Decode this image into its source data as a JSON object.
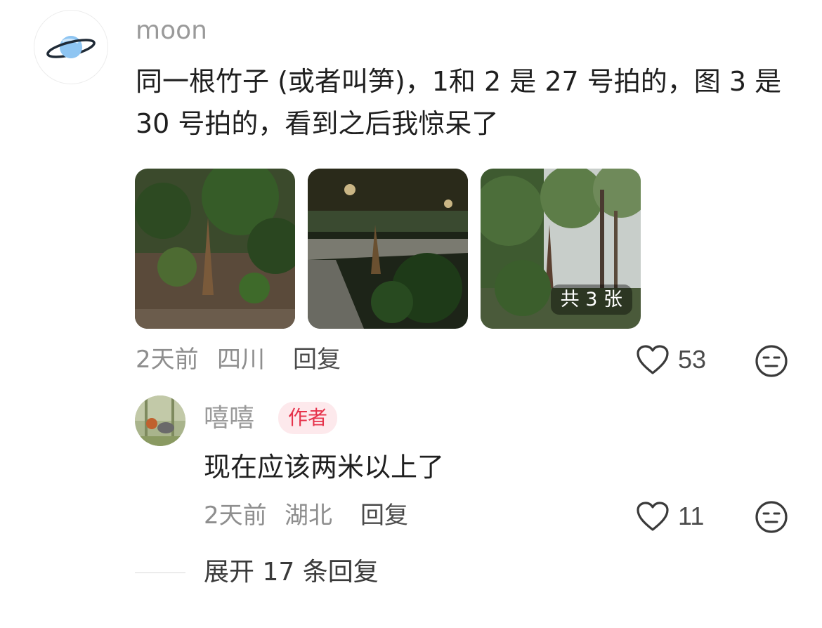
{
  "main_comment": {
    "username": "moon",
    "text": "同一根竹子 (或者叫笋)，1和 2 是 27 号拍的，图 3 是 30 号拍的，看到之后我惊呆了",
    "images": [
      {
        "alt": "bamboo-shoot-photo-1"
      },
      {
        "alt": "bamboo-shoot-photo-2"
      },
      {
        "alt": "bamboo-shoot-photo-3"
      }
    ],
    "image_count_label": "共 3 张",
    "time": "2天前",
    "location": "四川",
    "reply_label": "回复",
    "like_count": "53",
    "icons": {
      "avatar": "planet-icon",
      "like": "heart-icon",
      "dislike": "meh-face-icon"
    }
  },
  "sub_comment": {
    "username": "嘻嘻",
    "badge": "作者",
    "text": "现在应该两米以上了",
    "time": "2天前",
    "location": "湖北",
    "reply_label": "回复",
    "like_count": "11"
  },
  "expand_label": "展开 17 条回复",
  "colors": {
    "badge_bg": "#fde9ec",
    "badge_text": "#e6334b",
    "meta_text": "#8e8e8e",
    "planet_blue": "#8ec5f2"
  }
}
